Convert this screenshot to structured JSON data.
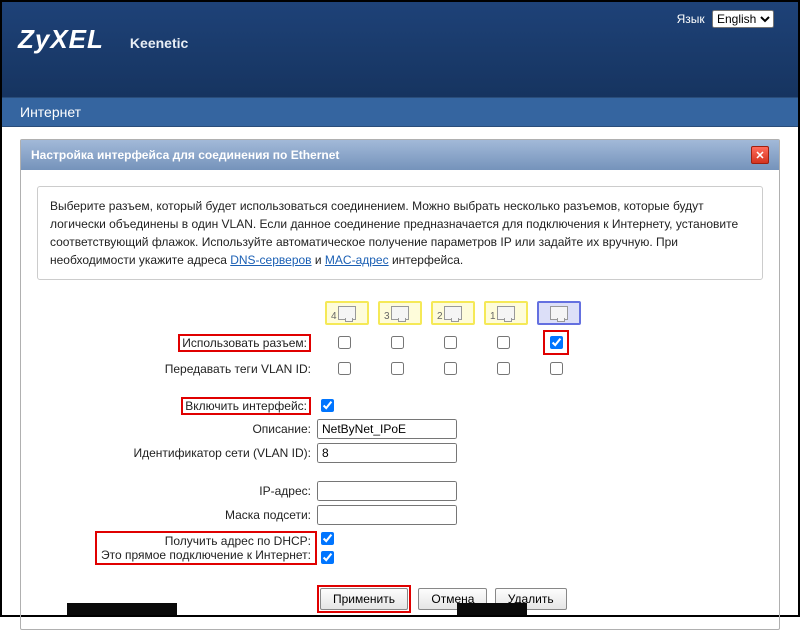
{
  "lang": {
    "label": "Язык",
    "value": "English"
  },
  "brand": {
    "logo": "ZyXEL",
    "model": "Keenetic"
  },
  "section": "Интернет",
  "panel": {
    "title": "Настройка интерфейса для соединения по Ethernet",
    "desc_p1": "Выберите разъем, который будет использоваться соединением. Можно выбрать несколько разъемов, которые будут логически объединены в один VLAN. Если данное соединение предназначается для подключения к Интернету, установите соответствующий флажок. Используйте автоматическое получение параметров IP или задайте их вручную. При необходимости укажите адреса ",
    "link1": "DNS-серверов",
    "desc_and": " и ",
    "link2": "MAC-адрес",
    "desc_p2": " интерфейса."
  },
  "ports": [
    "4",
    "3",
    "2",
    "1",
    ""
  ],
  "labels": {
    "use_port": "Использовать разъем:",
    "vlan_tag": "Передавать теги VLAN ID:",
    "enable_iface": "Включить интерфейс:",
    "description": "Описание:",
    "vlan_id": "Идентификатор сети (VLAN ID):",
    "ip": "IP-адрес:",
    "mask": "Маска подсети:",
    "dhcp": "Получить адрес по DHCP:",
    "direct": "Это прямое подключение к Интернет:"
  },
  "values": {
    "description": "NetByNet_IPoE",
    "vlan_id": "8",
    "ip": "",
    "mask": ""
  },
  "buttons": {
    "apply": "Применить",
    "cancel": "Отмена",
    "delete": "Удалить"
  }
}
